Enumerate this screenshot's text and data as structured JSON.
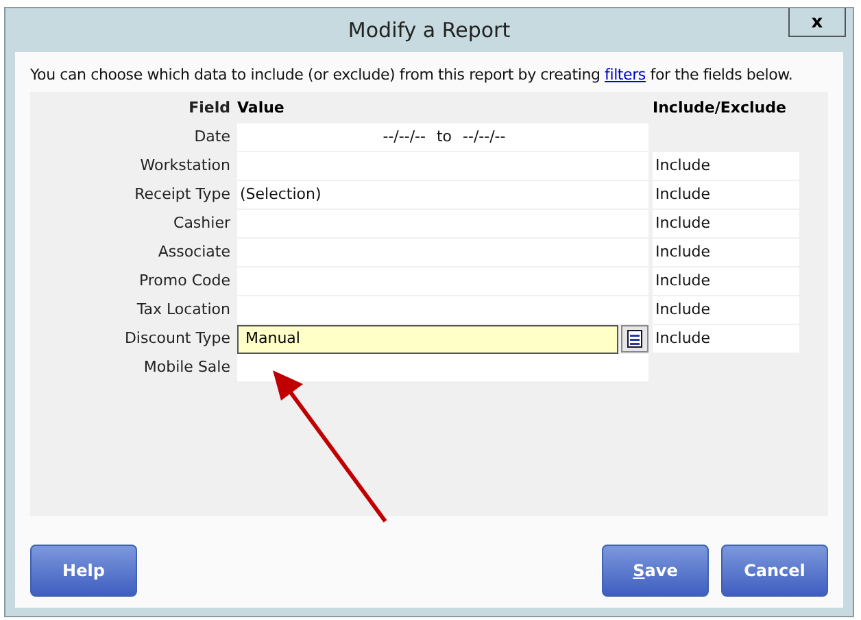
{
  "window": {
    "title": "Modify a Report",
    "close": "x"
  },
  "intro": {
    "before": "You can choose which data to include (or exclude) from this report by creating ",
    "link": "filters",
    "after": " for the fields below."
  },
  "table": {
    "columns": [
      "Field",
      "Value",
      "Include/Exclude"
    ],
    "rows": [
      {
        "kind": "date",
        "field": "Date",
        "from": "--/--/--",
        "sep": "to",
        "to": "--/--/--"
      },
      {
        "kind": "text",
        "field": "Workstation",
        "value": "",
        "include": "Include"
      },
      {
        "kind": "text",
        "field": "Receipt Type",
        "value": "(Selection)",
        "include": "Include"
      },
      {
        "kind": "text",
        "field": "Cashier",
        "value": "",
        "include": "Include"
      },
      {
        "kind": "text",
        "field": "Associate",
        "value": "",
        "include": "Include"
      },
      {
        "kind": "text",
        "field": "Promo Code",
        "value": "",
        "include": "Include"
      },
      {
        "kind": "text",
        "field": "Tax Location",
        "value": "",
        "include": "Include"
      },
      {
        "kind": "picker",
        "field": "Discount Type",
        "value": "Manual",
        "include": "Include"
      },
      {
        "kind": "text",
        "field": "Mobile Sale",
        "value": ""
      }
    ]
  },
  "annotation": {
    "kind": "arrow"
  },
  "left_buttons": [
    {
      "label": "Help",
      "mnemonic_underlined": false
    }
  ],
  "right_buttons": [
    {
      "label": "Save",
      "mnemonic_underlined": true
    },
    {
      "label": "Cancel",
      "mnemonic_underlined": false
    }
  ]
}
